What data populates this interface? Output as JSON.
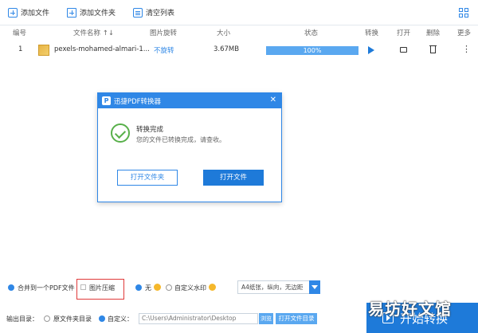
{
  "toolbar": {
    "add_file": "添加文件",
    "add_folder": "添加文件夹",
    "clear_list": "清空列表"
  },
  "columns": {
    "index": "编号",
    "name": "文件名称 ↑↓",
    "rotate": "图片旋转",
    "size": "大小",
    "status": "状态",
    "convert": "转换",
    "open": "打开",
    "delete": "删除",
    "more": "更多"
  },
  "file": {
    "index": "1",
    "name": "pexels-mohamed-almari-1...",
    "rotate": "不旋转",
    "size": "3.67MB",
    "progress_text": "100%",
    "progress": 1.0
  },
  "dialog": {
    "title": "迅捷PDF转换器",
    "heading": "转换完成",
    "message": "您的文件已转换完成，请查收。",
    "open_folder": "打开文件夹",
    "open_file": "打开文件"
  },
  "options": {
    "merge_pdf": "合并到一个PDF文件",
    "compress": "图片压缩",
    "none": "无",
    "custom_watermark": "自定义水印",
    "page_setting": "A4纸张，纵向，无边距"
  },
  "output": {
    "label": "输出目录：",
    "source_dir": "原文件夹目录",
    "custom": "自定义：",
    "path": "C:\\Users\\Administrator\\Desktop",
    "browse": "浏览",
    "open_folder": "打开文件目录"
  },
  "start_button": "开始转换",
  "watermark_text": "易坊好文馆",
  "colors": {
    "accent": "#2f87e6",
    "primary": "#1e7ad9",
    "success": "#58b04a",
    "highlight": "#e03a3a"
  }
}
